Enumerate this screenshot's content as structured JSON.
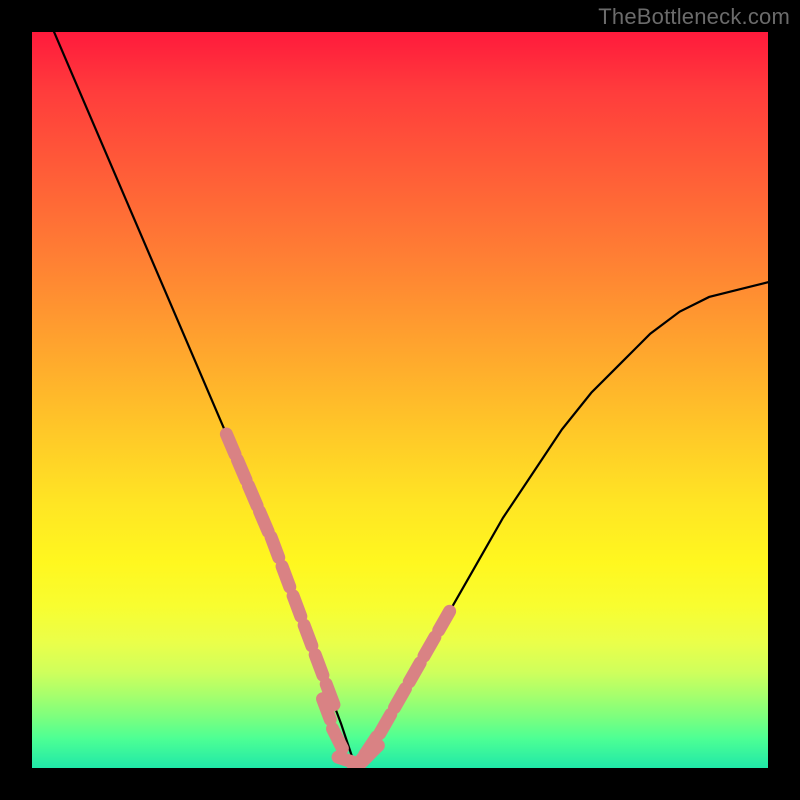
{
  "watermark": "TheBottleneck.com",
  "chart_data": {
    "type": "line",
    "title": "",
    "xlabel": "",
    "ylabel": "",
    "xlim": [
      0,
      100
    ],
    "ylim": [
      0,
      100
    ],
    "grid": false,
    "legend": false,
    "series": [
      {
        "name": "bottleneck-curve",
        "kind": "line",
        "color": "#000000",
        "x": [
          3,
          6,
          9,
          12,
          15,
          18,
          21,
          24,
          27,
          30,
          33,
          36,
          39,
          42,
          44,
          48,
          52,
          56,
          60,
          64,
          68,
          72,
          76,
          80,
          84,
          88,
          92,
          96,
          100
        ],
        "values": [
          0,
          7,
          14,
          21,
          28,
          35,
          42,
          49,
          56,
          63,
          70,
          78,
          86,
          94,
          100,
          94,
          87,
          80,
          73,
          66,
          60,
          54,
          49,
          45,
          41,
          38,
          36,
          35,
          34
        ]
      },
      {
        "name": "highlight-left",
        "kind": "segments",
        "color": "#d98284",
        "x": [
          27,
          28.5,
          30,
          31.5,
          33,
          34.5,
          36,
          37.5,
          39,
          40.5
        ],
        "values": [
          56,
          59.5,
          63,
          66.5,
          70,
          74,
          78,
          82,
          86,
          90
        ]
      },
      {
        "name": "highlight-right",
        "kind": "segments",
        "color": "#d98284",
        "x": [
          44,
          46,
          48,
          50,
          52,
          54,
          56
        ],
        "values": [
          100,
          97,
          94,
          90.5,
          87,
          83.5,
          80
        ]
      },
      {
        "name": "highlight-bottom",
        "kind": "segments",
        "color": "#d98284",
        "x": [
          40,
          41.5,
          43,
          44.5,
          46
        ],
        "values": [
          92,
          96,
          99,
          99.5,
          98
        ]
      }
    ]
  }
}
